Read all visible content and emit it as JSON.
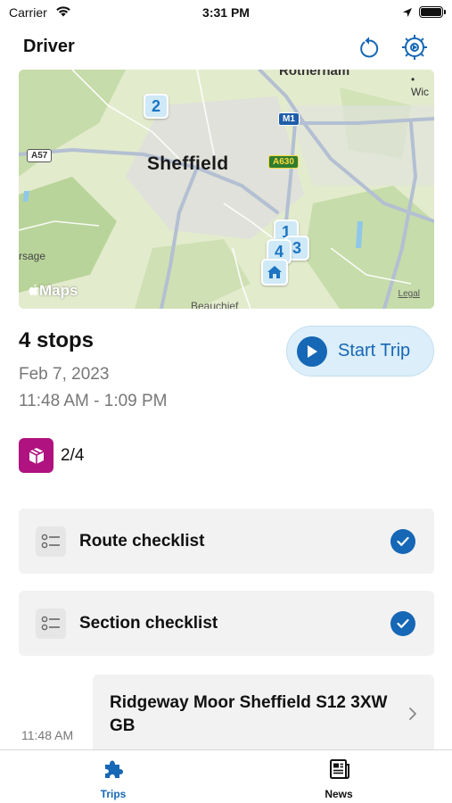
{
  "status_bar": {
    "carrier": "Carrier",
    "time": "3:31 PM",
    "icons": [
      "wifi-icon",
      "location-arrow-icon",
      "battery-icon"
    ]
  },
  "nav": {
    "title": "Driver",
    "actions": [
      {
        "icon": "refresh-icon"
      },
      {
        "icon": "settings-gear-icon"
      }
    ]
  },
  "map": {
    "city_label": "Sheffield",
    "town_label": "Rotherham",
    "corner_label": "Wic",
    "left_label": "rsage",
    "bottom_label": "Beauchief",
    "road_badges": {
      "m1": "M1",
      "a630": "A630",
      "a57": "A57"
    },
    "pins": {
      "p1": "1",
      "p2": "2",
      "p3": "3",
      "p4": "4"
    },
    "maps_logo": "Maps",
    "legal_label": "Legal"
  },
  "trip": {
    "title": "4 stops",
    "date": "Feb 7, 2023",
    "time_range": "11:48 AM - 1:09 PM",
    "start_button_label": "Start Trip",
    "package_count": "2/4"
  },
  "checklists": [
    {
      "label": "Route checklist",
      "completed": true
    },
    {
      "label": "Section checklist",
      "completed": true
    }
  ],
  "stops": [
    {
      "time": "11:48 AM",
      "address": "Ridgeway Moor Sheffield S12 3XW GB"
    }
  ],
  "tabs": [
    {
      "label": "Trips",
      "icon": "puzzle-icon",
      "active": true
    },
    {
      "label": "News",
      "icon": "newspaper-icon",
      "active": false
    }
  ],
  "colors": {
    "accent": "#1667b5",
    "package_badge": "#b0127f",
    "card_background": "#f2f2f2",
    "start_button_background": "#dbeef9"
  }
}
